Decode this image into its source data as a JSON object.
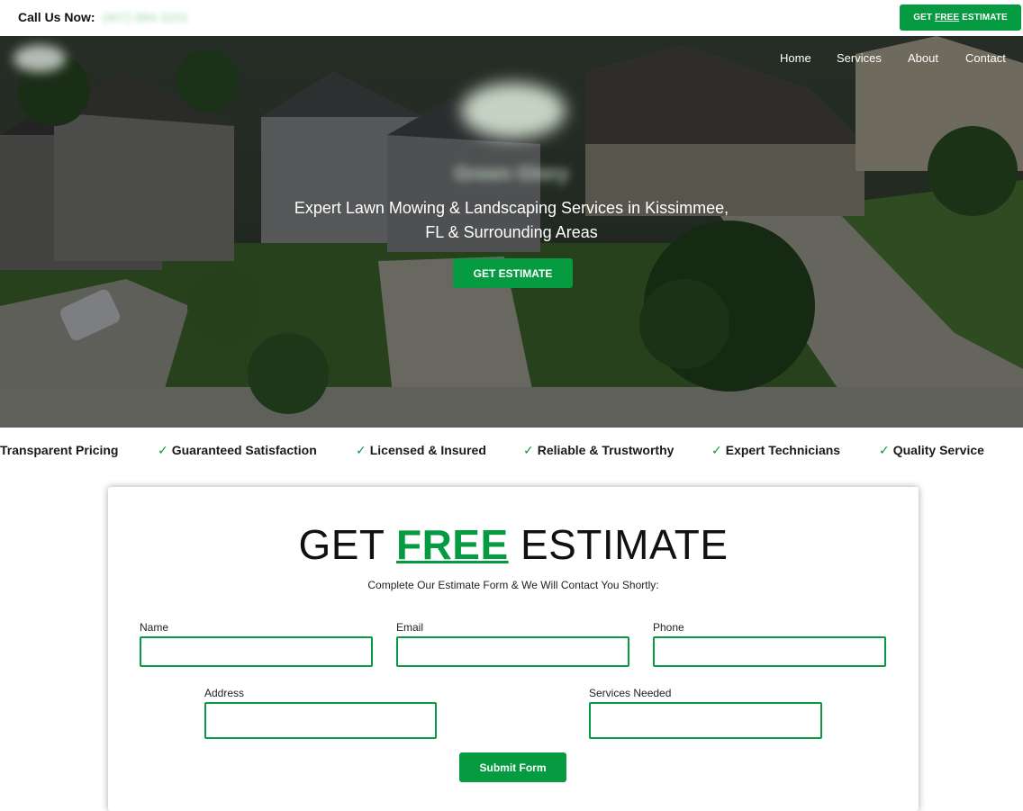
{
  "topbar": {
    "call_label": "Call Us Now:",
    "phone": "(407) 864-3201",
    "cta_prefix": "GET",
    "cta_highlight": "FREE",
    "cta_suffix": "ESTIMATE"
  },
  "nav": {
    "items": [
      {
        "label": "Home"
      },
      {
        "label": "Services"
      },
      {
        "label": "About"
      },
      {
        "label": "Contact"
      }
    ]
  },
  "hero": {
    "brand_name": "Green Glory",
    "title": "Expert Lawn Mowing & Landscaping Services in Kissimmee, FL & Surrounding Areas",
    "cta_label": "GET ESTIMATE"
  },
  "features": {
    "check_glyph": "✓",
    "items": [
      {
        "label": "Transparent Pricing"
      },
      {
        "label": "Guaranteed Satisfaction"
      },
      {
        "label": "Licensed & Insured"
      },
      {
        "label": "Reliable & Trustworthy"
      },
      {
        "label": "Expert Technicians"
      },
      {
        "label": "Quality Service"
      }
    ]
  },
  "form": {
    "heading_prefix": "GET",
    "heading_highlight": "FREE",
    "heading_suffix": "ESTIMATE",
    "subtitle": "Complete Our Estimate Form & We Will Contact You Shortly:",
    "fields": {
      "name": {
        "label": "Name",
        "value": ""
      },
      "email": {
        "label": "Email",
        "value": ""
      },
      "phone": {
        "label": "Phone",
        "value": ""
      },
      "address": {
        "label": "Address",
        "value": ""
      },
      "services": {
        "label": "Services Needed",
        "value": ""
      }
    },
    "submit_label": "Submit Form"
  },
  "colors": {
    "accent": "#079b41",
    "text": "#111111",
    "background": "#ffffff"
  },
  "icons": {
    "feature_check": "check-icon"
  }
}
